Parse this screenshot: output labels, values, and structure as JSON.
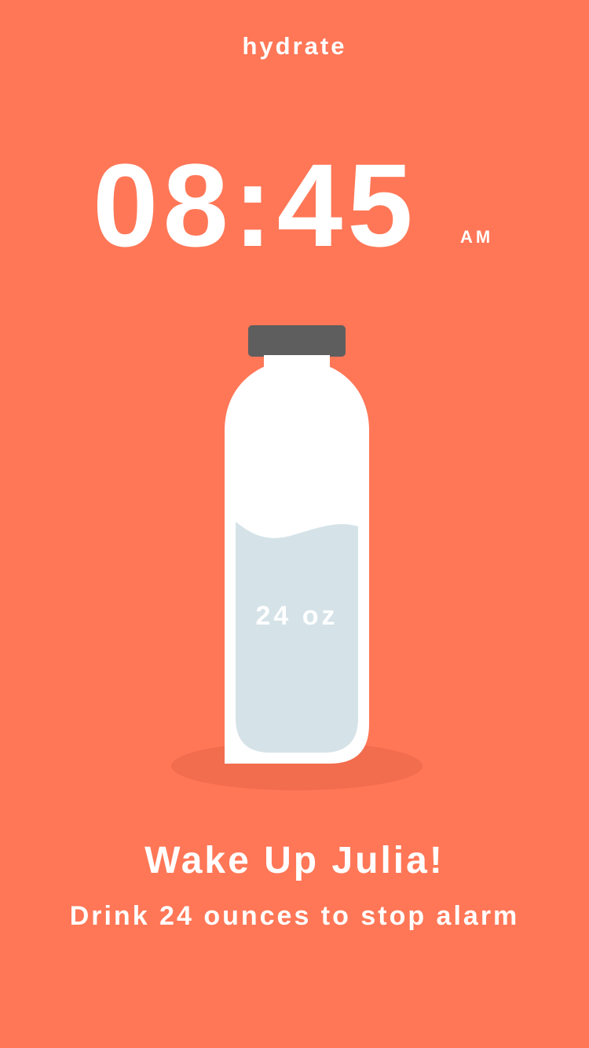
{
  "app": {
    "title": "hydrate"
  },
  "alarm": {
    "time": "08:45",
    "meridiem": "AM"
  },
  "bottle": {
    "volume_label": "24 oz",
    "fill_fraction": 0.58,
    "cap_color": "#5E5E5E",
    "water_color": "#D5E3E8"
  },
  "message": {
    "headline": "Wake Up Julia!",
    "instruction": "Drink 24 ounces to stop alarm"
  },
  "colors": {
    "background": "#FF7757",
    "text": "#FFFFFF"
  }
}
